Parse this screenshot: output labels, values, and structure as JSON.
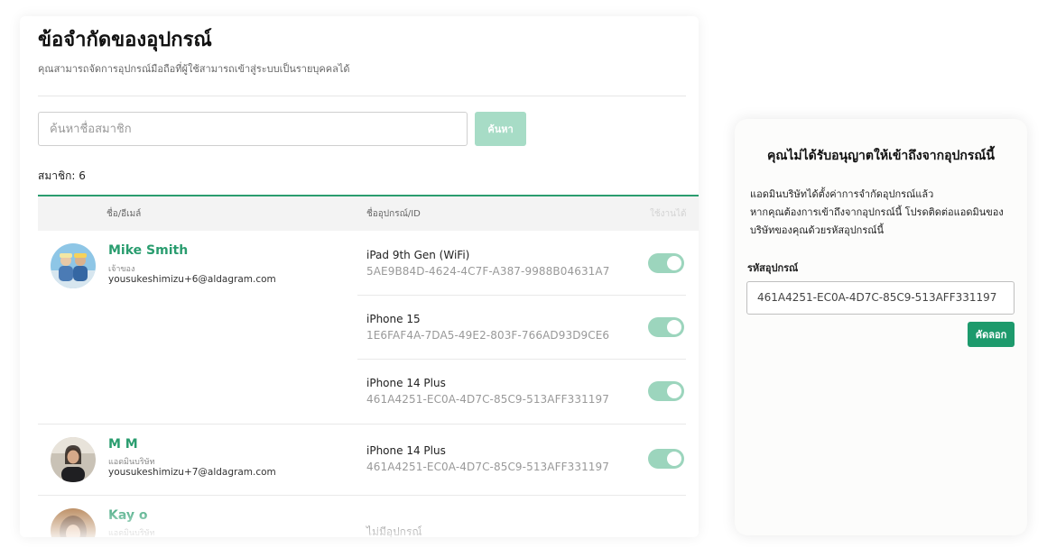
{
  "page": {
    "title": "ข้อจำกัดของอุปกรณ์",
    "subtitle": "คุณสามารถจัดการอุปกรณ์มือถือที่ผู้ใช้สามารถเข้าสู่ระบบเป็นรายบุคคลได้"
  },
  "search": {
    "placeholder": "ค้นหาชื่อสมาชิก",
    "button_label": "ค้นหา"
  },
  "member_count": "สมาชิก: 6",
  "table": {
    "headers": {
      "member": "ชื่อ/อีเมล์",
      "device": "ชื่ออุปกรณ์/ID",
      "enabled": "ใช้งานได้"
    },
    "members": [
      {
        "name": "Mike Smith",
        "role": "เจ้าของ",
        "email": "yousukeshimizu+6@aldagram.com",
        "devices": [
          {
            "name": "iPad 9th Gen (WiFi)",
            "id": "5AE9B84D-4624-4C7F-A387-9988B04631A7",
            "enabled": true
          },
          {
            "name": "iPhone 15",
            "id": "1E6FAF4A-7DA5-49E2-803F-766AD93D9CE6",
            "enabled": true
          },
          {
            "name": "iPhone 14 Plus",
            "id": "461A4251-EC0A-4D7C-85C9-513AFF331197",
            "enabled": true
          }
        ]
      },
      {
        "name": "M M",
        "role": "แอดมินบริษัท",
        "email": "yousukeshimizu+7@aldagram.com",
        "devices": [
          {
            "name": "iPhone 14 Plus",
            "id": "461A4251-EC0A-4D7C-85C9-513AFF331197",
            "enabled": true
          }
        ]
      },
      {
        "name": "Kay o",
        "role": "แอดมินบริษัท",
        "no_device": "ไม่มีอุปกรณ์"
      }
    ]
  },
  "blocked_dialog": {
    "title": "คุณไม่ได้รับอนุญาตให้เข้าถึงจากอุปกรณ์นี้",
    "body_line1": "แอดมินบริษัทได้ตั้งค่าการจำกัดอุปกรณ์แล้ว",
    "body_line2": "หากคุณต้องการเข้าถึงจากอุปกรณ์นี้ โปรดติดต่อแอดมินของ",
    "body_line3": "บริษัทของคุณด้วยรหัสอุปกรณ์นี้",
    "device_code_label": "รหัสอุปกรณ์",
    "device_code": "461A4251-EC0A-4D7C-85C9-513AFF331197",
    "copy_label": "คัดลอก"
  },
  "colors": {
    "accent": "#2a9d6f",
    "toggle_on": "#9cd5bd",
    "search_button": "#a7dcc6",
    "copy_button": "#1d9a6c"
  }
}
